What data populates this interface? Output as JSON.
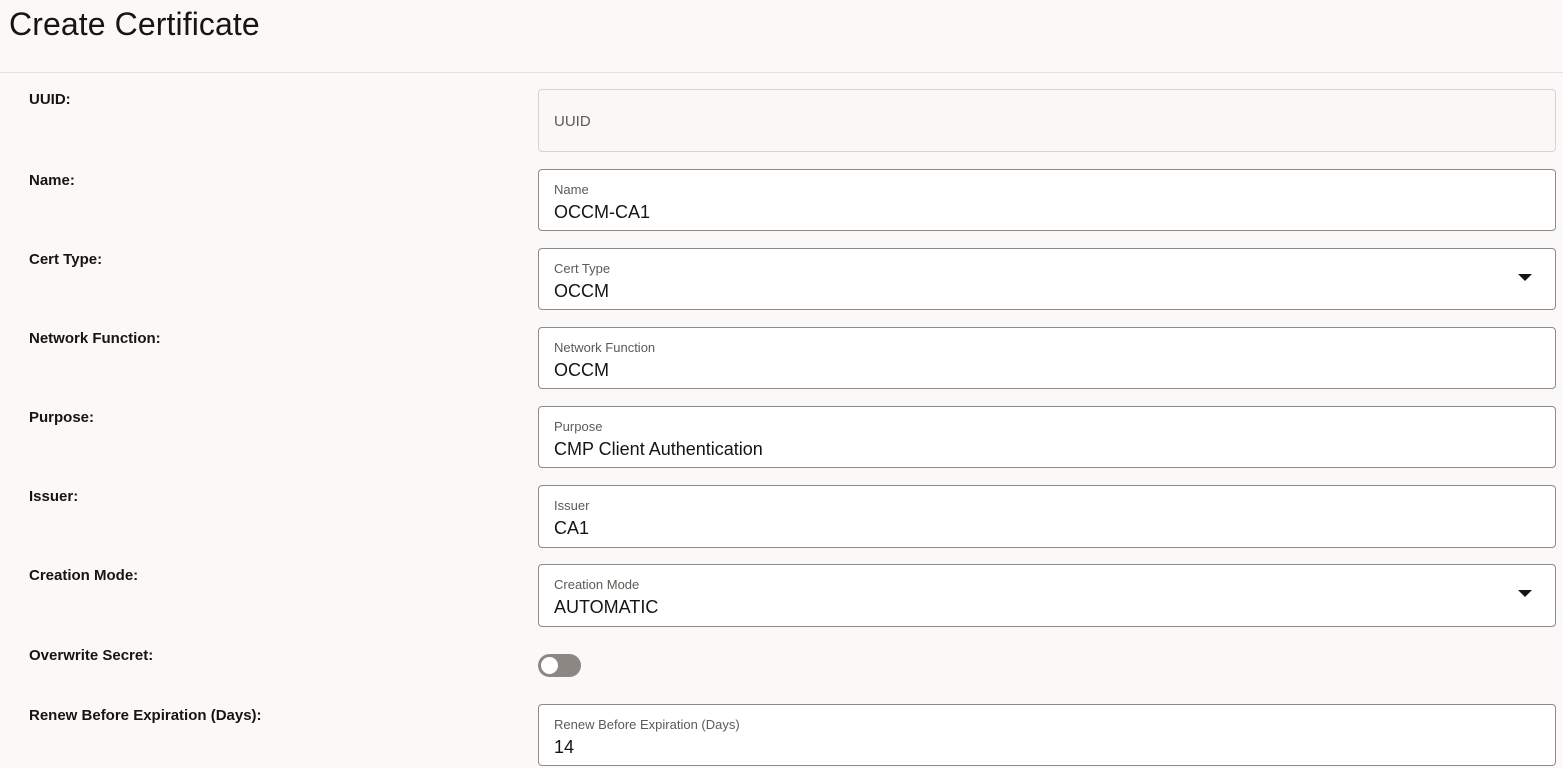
{
  "page": {
    "title": "Create Certificate"
  },
  "form": {
    "uuid": {
      "row_label": "UUID:",
      "placeholder": "UUID"
    },
    "name": {
      "row_label": "Name:",
      "field_label": "Name",
      "value": "OCCM-CA1"
    },
    "cert_type": {
      "row_label": "Cert Type:",
      "field_label": "Cert Type",
      "value": "OCCM"
    },
    "network_function": {
      "row_label": "Network Function:",
      "field_label": "Network Function",
      "value": "OCCM"
    },
    "purpose": {
      "row_label": "Purpose:",
      "field_label": "Purpose",
      "value": "CMP Client Authentication"
    },
    "issuer": {
      "row_label": "Issuer:",
      "field_label": "Issuer",
      "value": "CA1"
    },
    "creation_mode": {
      "row_label": "Creation Mode:",
      "field_label": "Creation Mode",
      "value": "AUTOMATIC"
    },
    "overwrite_secret": {
      "row_label": "Overwrite Secret:",
      "checked": false
    },
    "renew_before_expiration": {
      "row_label": "Renew Before Expiration (Days):",
      "field_label": "Renew Before Expiration (Days)",
      "value": "14"
    }
  },
  "icons": {
    "dropdown": "chevron-down-icon"
  },
  "colors": {
    "background": "#faf9f8",
    "field_border": "#8f8a85",
    "toggle_off": "#8c8782"
  }
}
